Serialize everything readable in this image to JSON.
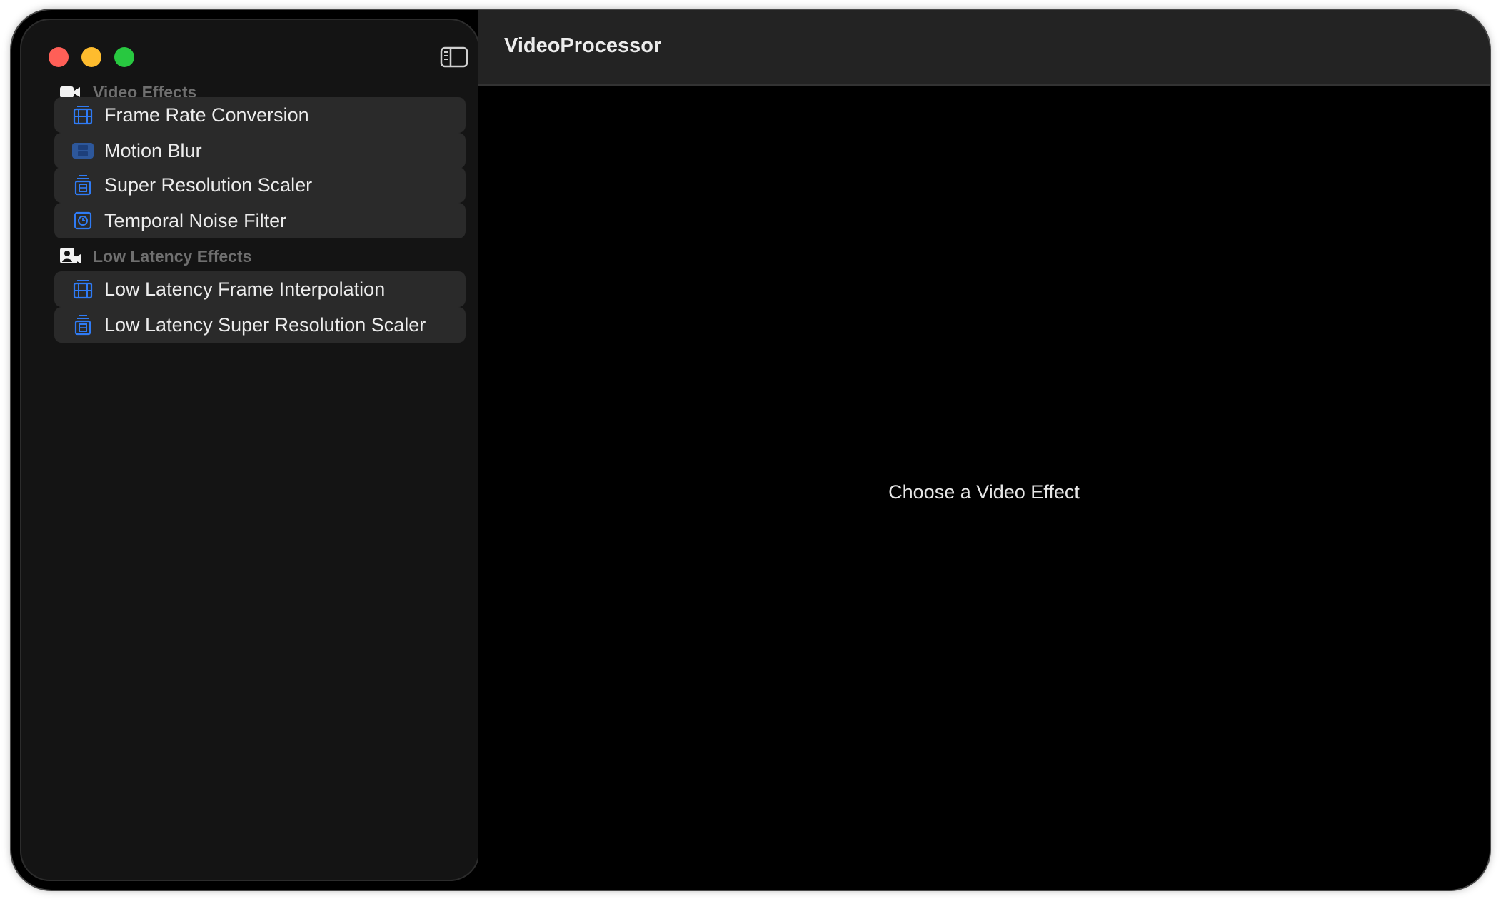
{
  "window": {
    "title": "VideoProcessor"
  },
  "sidebar": {
    "sections": [
      {
        "label": "Video Effects",
        "icon": "video-camera-icon",
        "items": [
          {
            "label": "Frame Rate Conversion",
            "icon": "film-frames-icon"
          },
          {
            "label": "Motion Blur",
            "icon": "film-strip-icon"
          },
          {
            "label": "Super Resolution Scaler",
            "icon": "film-stack-icon"
          },
          {
            "label": "Temporal Noise Filter",
            "icon": "timer-clock-icon"
          }
        ]
      },
      {
        "label": "Low Latency Effects",
        "icon": "person-video-icon",
        "items": [
          {
            "label": "Low Latency Frame Interpolation",
            "icon": "film-frames-icon"
          },
          {
            "label": "Low Latency Super Resolution Scaler",
            "icon": "film-stack-icon"
          }
        ]
      }
    ]
  },
  "main": {
    "placeholder": "Choose a Video Effect"
  },
  "colors": {
    "accent_blue": "#2f7bf5",
    "close": "#ff5f57",
    "minimize": "#febc2e",
    "maximize": "#28c840",
    "item_background": "#2a2a2a",
    "sidebar_background": "#141414"
  }
}
